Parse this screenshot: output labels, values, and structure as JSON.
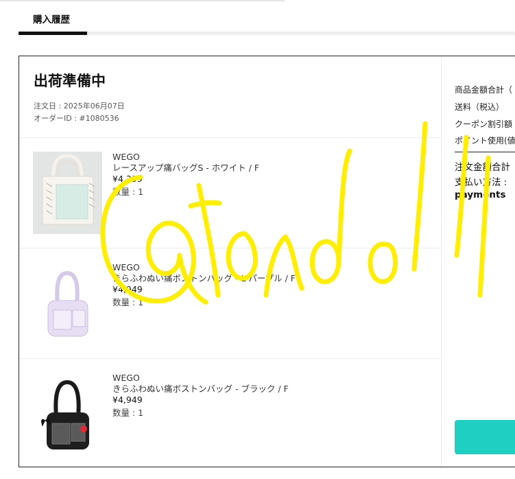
{
  "tabs": {
    "active_label": "購入履歴"
  },
  "order": {
    "status": "出荷準備中",
    "order_date": "注文日 : 2025年06月07日",
    "order_id": "オーダーID : #1080536",
    "items": [
      {
        "brand": "WEGO",
        "name": "レースアップ痛バッグS - ホワイト / F",
        "price": "¥4,399",
        "quantity": "数量 : 1"
      },
      {
        "brand": "WEGO",
        "name": "きらふわぬい痛ボストンバッグ - L パープル / F",
        "price": "¥4,949",
        "quantity": "数量 : 1"
      },
      {
        "brand": "WEGO",
        "name": "きらふわぬい痛ボストンバッグ - ブラック / F",
        "price": "¥4,949",
        "quantity": "数量 : 1"
      }
    ]
  },
  "summary": {
    "subtotal_label": "商品金額合計（",
    "shipping_label": "送料（税込）",
    "coupon_label": "クーポン割引額",
    "points_label": "ポイント使用(値",
    "total_label": "注文金額合計",
    "payment_label": "支払い方法 : ",
    "payment_value": "payments"
  },
  "colors": {
    "accent": "#1fcfc2",
    "watermark": "#ffee00",
    "text": "#111111",
    "muted": "#555555"
  },
  "watermark": {
    "text": "@tonodoll"
  },
  "icons": {
    "item_1": "white-tote-bag-photo",
    "item_2": "purple-boston-bag-photo",
    "item_3": "black-boston-bag-photo"
  }
}
